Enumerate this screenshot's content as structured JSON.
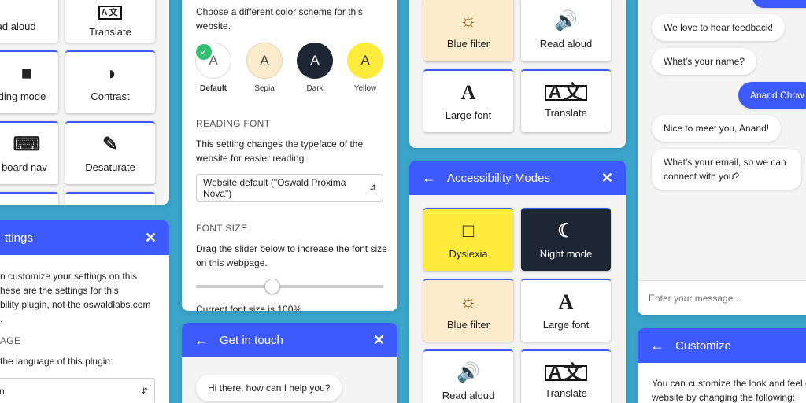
{
  "colors": {
    "accent": "#3d5afe",
    "background": "#3ba4c9",
    "beige": "#fdeccb",
    "yellow": "#ffeb3b",
    "dark": "#1c2733"
  },
  "left_panel_top": {
    "tiles": [
      {
        "label": "ead aloud",
        "icon": "speaker-icon"
      },
      {
        "label": "Translate",
        "icon": "translate-icon"
      },
      {
        "label": "ding mode",
        "icon": "book-icon"
      },
      {
        "label": "Contrast",
        "icon": "contrast-icon"
      },
      {
        "label": "board nav",
        "icon": "keyboard-icon"
      },
      {
        "label": "Desaturate",
        "icon": "brush-icon"
      }
    ]
  },
  "settings_panel": {
    "title": "ttings",
    "paragraph": [
      "n customize your settings on this",
      "hese are the settings for this",
      "bility plugin, not the oswaldlabs.com",
      "."
    ],
    "section_label": "AGE",
    "section_text": "the language of this plugin:",
    "select_value": "n"
  },
  "color_scheme_panel": {
    "intro": [
      "Choose a different color scheme for this",
      "website."
    ],
    "schemes": [
      {
        "letter": "A",
        "label": "Default"
      },
      {
        "letter": "A",
        "label": "Sepia"
      },
      {
        "letter": "A",
        "label": "Dark"
      },
      {
        "letter": "A",
        "label": "Yellow"
      }
    ],
    "reading_font_label": "READING FONT",
    "reading_font_text": [
      "This setting changes the typeface of the",
      "website for easier reading."
    ],
    "font_select": "Website default (\"Oswald Proxima Nova\")",
    "font_size_label": "FONT SIZE",
    "font_size_text": [
      "Drag the slider below to increase the font size",
      "on this webpage."
    ],
    "font_size_value": 0.4,
    "current_font": "Current font size is 100%"
  },
  "get_in_touch": {
    "title": "Get in touch",
    "message": "Hi there, how can I help you?"
  },
  "modes_top": {
    "tiles": [
      {
        "label": "Blue filter",
        "icon": "sun-icon"
      },
      {
        "label": "Read aloud",
        "icon": "speaker-icon"
      },
      {
        "label": "Large font",
        "icon": "font-icon"
      },
      {
        "label": "Translate",
        "icon": "translate-icon"
      }
    ]
  },
  "accessibility_modes": {
    "title": "Accessibility Modes",
    "tiles": [
      {
        "label": "Dyslexia",
        "icon": "reading-icon"
      },
      {
        "label": "Night mode",
        "icon": "moon-icon"
      },
      {
        "label": "Blue filter",
        "icon": "sun-icon"
      },
      {
        "label": "Large font",
        "icon": "font-icon"
      },
      {
        "label": "Read aloud",
        "icon": "speaker-icon"
      },
      {
        "label": "Translate",
        "icon": "translate-icon"
      }
    ]
  },
  "chat_panel": {
    "messages": [
      {
        "text": "We love to hear feedback!",
        "from": "bot"
      },
      {
        "text": "What's your name?",
        "from": "bot"
      },
      {
        "text": "Anand Chow",
        "from": "user"
      },
      {
        "text": "Nice to meet you, Anand!",
        "from": "bot"
      },
      {
        "text": "What's your email, so we can connect with you?",
        "from": "bot"
      }
    ],
    "input_placeholder": "Enter your message..."
  },
  "customize_panel": {
    "title": "Customize",
    "text": [
      "You can customize the look and feel of",
      "website by changing the following:"
    ]
  }
}
